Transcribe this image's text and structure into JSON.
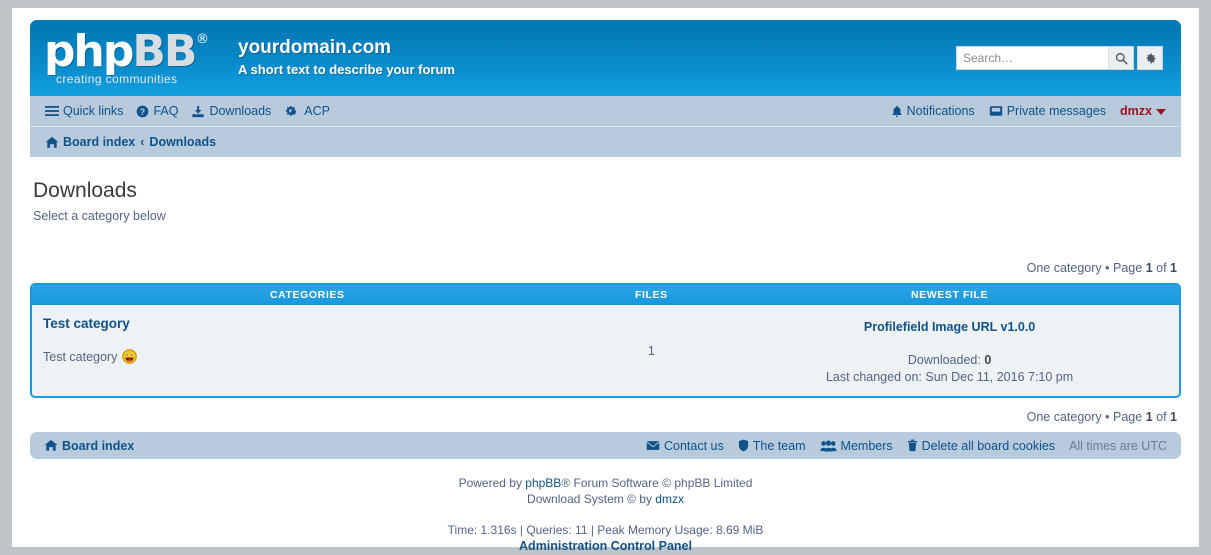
{
  "header": {
    "logo_text_a": "php",
    "logo_text_b": "BB",
    "logo_reg": "®",
    "logo_tagline": "creating communities",
    "site_title": "yourdomain.com",
    "site_description": "A short text to describe your forum",
    "search_placeholder": "Search…",
    "search_value": "",
    "search_button_icon": "search-icon",
    "advanced_search_icon": "gear-icon"
  },
  "nav": {
    "left": [
      {
        "label": "Quick links",
        "icon": "hamburger-icon"
      },
      {
        "label": "FAQ",
        "icon": "question-circle-icon"
      },
      {
        "label": "Downloads",
        "icon": "download-icon"
      },
      {
        "label": "ACP",
        "icon": "gears-icon"
      }
    ],
    "right": [
      {
        "label": "Notifications",
        "icon": "bell-icon"
      },
      {
        "label": "Private messages",
        "icon": "envelope-open-icon"
      }
    ],
    "username": "dmzx",
    "user_caret": "chevron-down-icon"
  },
  "breadcrumb": {
    "home_icon": "home-icon",
    "items": [
      "Board index",
      "Downloads"
    ],
    "separator": "‹"
  },
  "main": {
    "title": "Downloads",
    "subtitle": "Select a category below",
    "pagination": {
      "count_text": "One category",
      "bullet": "•",
      "page_word": "Page",
      "current_page": "1",
      "of_word": "of",
      "total_pages": "1"
    },
    "table": {
      "columns": [
        "CATEGORIES",
        "FILES",
        "NEWEST FILE"
      ],
      "rows": [
        {
          "category_name": "Test category",
          "category_desc": "Test category",
          "category_emoji": "smiley-tongue-icon",
          "files": "1",
          "newest_file": "Profilefield Image URL v1.0.0",
          "downloaded_label": "Downloaded:",
          "downloaded_count": "0",
          "last_changed_label": "Last changed on:",
          "last_changed_value": "Sun Dec 11, 2016 7:10 pm"
        }
      ]
    }
  },
  "footer_bar": {
    "home_label": "Board index",
    "home_icon": "home-icon",
    "links": [
      {
        "label": "Contact us",
        "icon": "envelope-icon"
      },
      {
        "label": "The team",
        "icon": "shield-icon"
      },
      {
        "label": "Members",
        "icon": "users-icon"
      },
      {
        "label": "Delete all board cookies",
        "icon": "trash-icon"
      }
    ],
    "timezone": "All times are UTC"
  },
  "copyright": {
    "line1_pre": "Powered by ",
    "line1_link": "phpBB",
    "line1_post": "® Forum Software © phpBB Limited",
    "line2_pre": "Download System © by ",
    "line2_link": "dmzx",
    "stats": "Time: 1.316s | Queries: 11 | Peak Memory Usage: 8.69 MiB",
    "acp": "Administration Control Panel"
  },
  "colors": {
    "header_top": "#0076b1",
    "header_bottom": "#12a0e0",
    "nav_bg": "#b8cbdd",
    "link": "#105289",
    "username": "#9e1421",
    "table_border": "#1b9ae0",
    "table_bg": "#eef2f5",
    "text_muted": "#536482"
  }
}
